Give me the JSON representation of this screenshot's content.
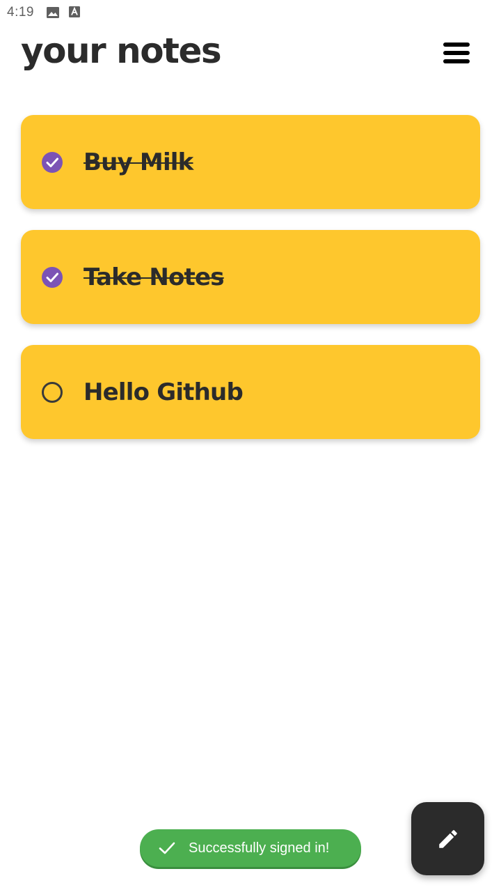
{
  "status_bar": {
    "time": "4:19",
    "icons": [
      "image-icon",
      "accessibility-a-icon"
    ]
  },
  "header": {
    "title": "your notes",
    "menu_icon": "hamburger-menu-icon"
  },
  "notes": [
    {
      "text": "Buy Milk",
      "completed": true
    },
    {
      "text": "Take Notes",
      "completed": true
    },
    {
      "text": "Hello Github",
      "completed": false
    }
  ],
  "toast": {
    "message": "Successfully signed in!",
    "icon": "check-icon"
  },
  "fab": {
    "icon": "pencil-icon"
  },
  "colors": {
    "note_card": "#fec72d",
    "check_filled": "#7c53b5",
    "toast_bg": "#4caf50",
    "fab_bg": "#2b2b2b",
    "text": "#2b2b2b"
  }
}
